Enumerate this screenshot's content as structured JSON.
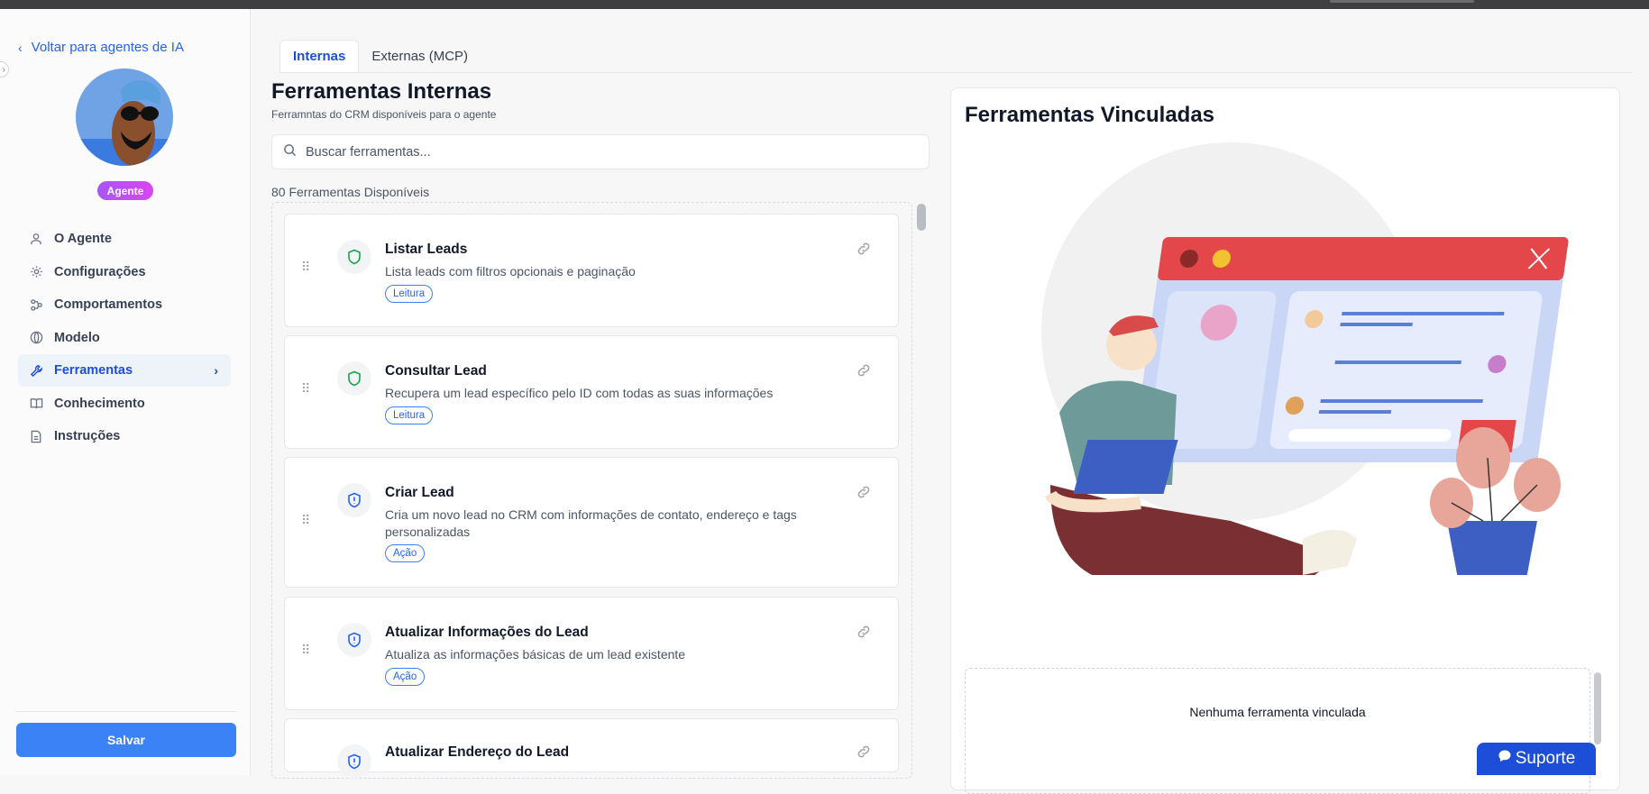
{
  "sidebar": {
    "back_label": "Voltar para agentes de IA",
    "badge": "Agente",
    "items": [
      {
        "label": "O Agente",
        "icon": "user-icon"
      },
      {
        "label": "Configurações",
        "icon": "gear-icon"
      },
      {
        "label": "Comportamentos",
        "icon": "workflow-icon"
      },
      {
        "label": "Modelo",
        "icon": "globe-icon"
      },
      {
        "label": "Ferramentas",
        "icon": "wrench-icon",
        "active": true
      },
      {
        "label": "Conhecimento",
        "icon": "book-icon"
      },
      {
        "label": "Instruções",
        "icon": "file-icon"
      }
    ],
    "save_label": "Salvar"
  },
  "tabs": [
    {
      "label": "Internas",
      "active": true
    },
    {
      "label": "Externas (MCP)",
      "active": false
    }
  ],
  "internal": {
    "title": "Ferramentas Internas",
    "subtitle": "Ferramntas do CRM disponíveis para o agente",
    "search_placeholder": "Buscar ferramentas...",
    "count_label": "80 Ferramentas Disponíveis",
    "tools": [
      {
        "title": "Listar Leads",
        "desc": "Lista leads com filtros opcionais e paginação",
        "tag": "Leitura",
        "icon": "shield-icon"
      },
      {
        "title": "Consultar Lead",
        "desc": "Recupera um lead específico pelo ID com todas as suas informações",
        "tag": "Leitura",
        "icon": "shield-icon"
      },
      {
        "title": "Criar Lead",
        "desc": "Cria um novo lead no CRM com informações de contato, endereço e tags personalizadas",
        "tag": "Ação",
        "icon": "shield-alert-icon"
      },
      {
        "title": "Atualizar Informações do Lead",
        "desc": "Atualiza as informações básicas de um lead existente",
        "tag": "Ação",
        "icon": "shield-alert-icon"
      },
      {
        "title": "Atualizar Endereço do Lead",
        "desc": "",
        "tag": "",
        "icon": "shield-alert-icon"
      }
    ]
  },
  "linked": {
    "title": "Ferramentas Vinculadas",
    "empty_label": "Nenhuma ferramenta vinculada"
  },
  "support_label": "Suporte",
  "colors": {
    "primary": "#3b82f6",
    "accent_dark": "#1d4ed8",
    "badge_gradient": [
      "#a855f7",
      "#d946ef"
    ],
    "read_shield": "#16a34a",
    "action_shield": "#2563eb"
  }
}
